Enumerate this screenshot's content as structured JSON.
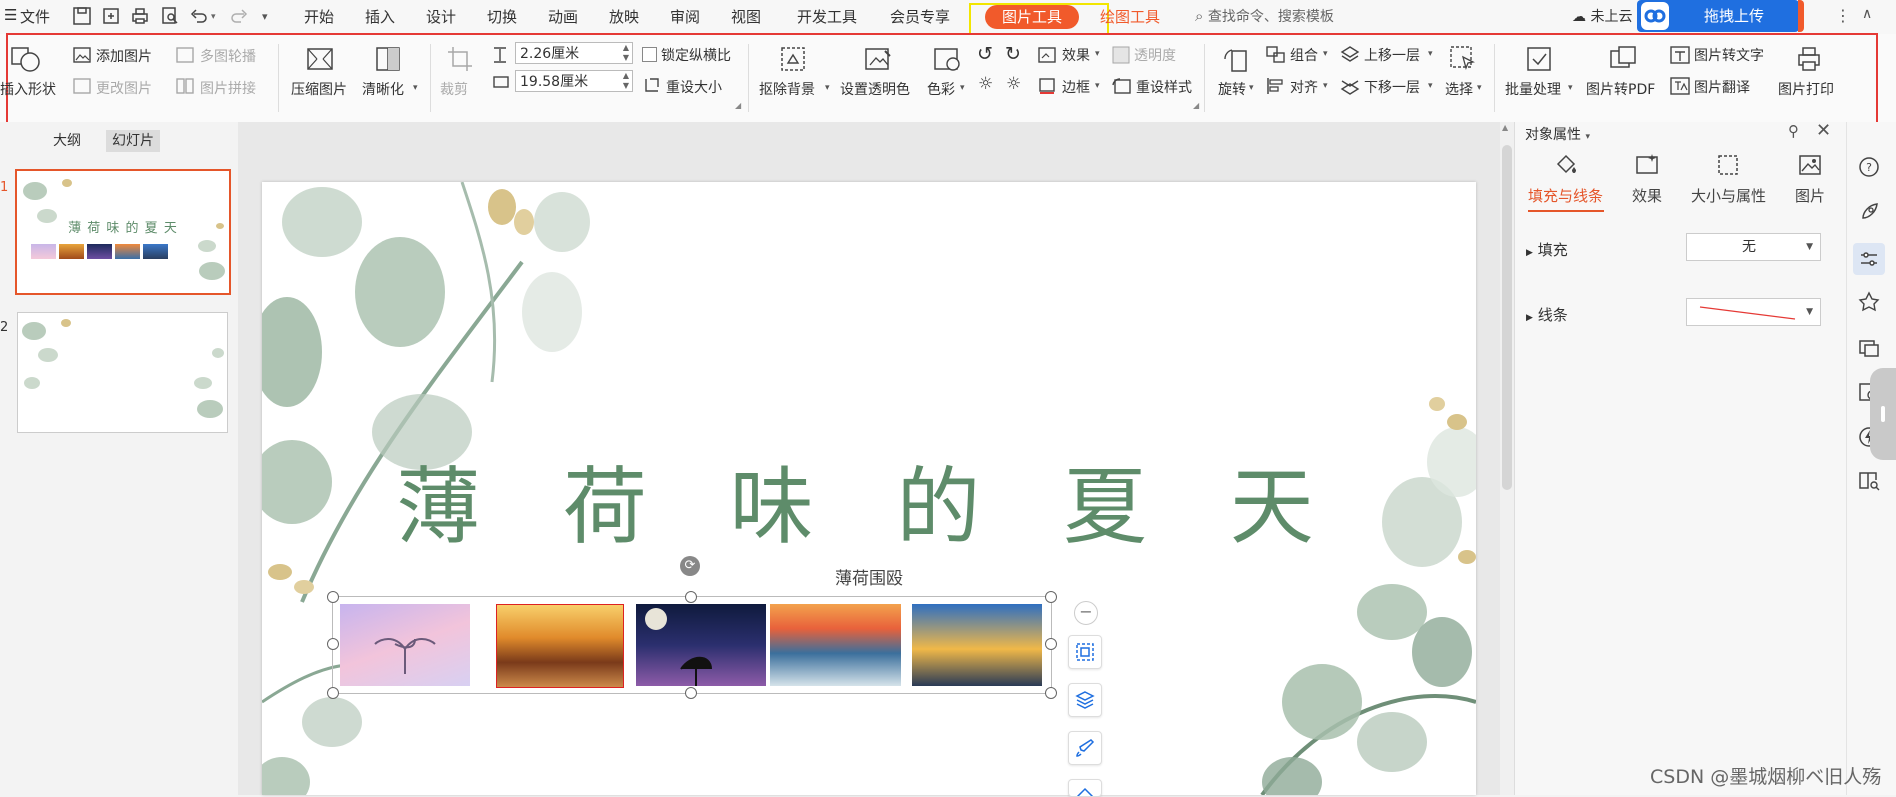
{
  "menubar": {
    "file": "文件",
    "tabs": [
      "开始",
      "插入",
      "设计",
      "切换",
      "动画",
      "放映",
      "审阅",
      "视图",
      "开发工具",
      "会员专享"
    ],
    "active_tab": "图片工具",
    "drawing_tab": "绘图工具",
    "search_placeholder": "查找命令、搜索模板",
    "cloud_status": "未上云",
    "upload_button": "拖拽上传",
    "colors": {
      "accent": "#f15a2b",
      "upload": "#1f6fe0",
      "highlight_box": "#f2e600"
    }
  },
  "ribbon": {
    "insert_shape": "插入形状",
    "add_picture": "添加图片",
    "multi_carousel": "多图轮播",
    "change_picture": "更改图片",
    "picture_collage": "图片拼接",
    "compress": "压缩图片",
    "sharpen": "清晰化",
    "crop": "裁剪",
    "height_value": "2.26厘米",
    "width_value": "19.58厘米",
    "lock_ratio": "锁定纵横比",
    "reset_size": "重设大小",
    "remove_bg": "抠除背景",
    "set_transparent": "设置透明色",
    "color": "色彩",
    "effects": "效果",
    "transparency": "透明度",
    "border": "边框",
    "reset_style": "重设样式",
    "rotate": "旋转",
    "group": "组合",
    "align": "对齐",
    "bring_forward": "上移一层",
    "send_backward": "下移一层",
    "select": "选择",
    "batch": "批量处理",
    "to_pdf": "图片转PDF",
    "to_text": "图片转文字",
    "translate": "图片翻译",
    "print": "图片打印",
    "highlight_color": "#e53935"
  },
  "leftpanel": {
    "tab_outline": "大纲",
    "tab_slides": "幻灯片",
    "slide1_num": "1",
    "slide2_num": "2",
    "slide1_title": "薄 荷 味 的 夏 天"
  },
  "slide": {
    "title": "薄 荷 味 的 夏 天",
    "subtitle": "薄荷围殴",
    "title_color": "#5e8c6a"
  },
  "rightpanel": {
    "title": "对象属性",
    "tabs": [
      "填充与线条",
      "效果",
      "大小与属性",
      "图片"
    ],
    "fill_label": "填充",
    "fill_value": "无",
    "line_label": "线条"
  },
  "watermark": "CSDN @墨城烟柳ベ旧人殇"
}
